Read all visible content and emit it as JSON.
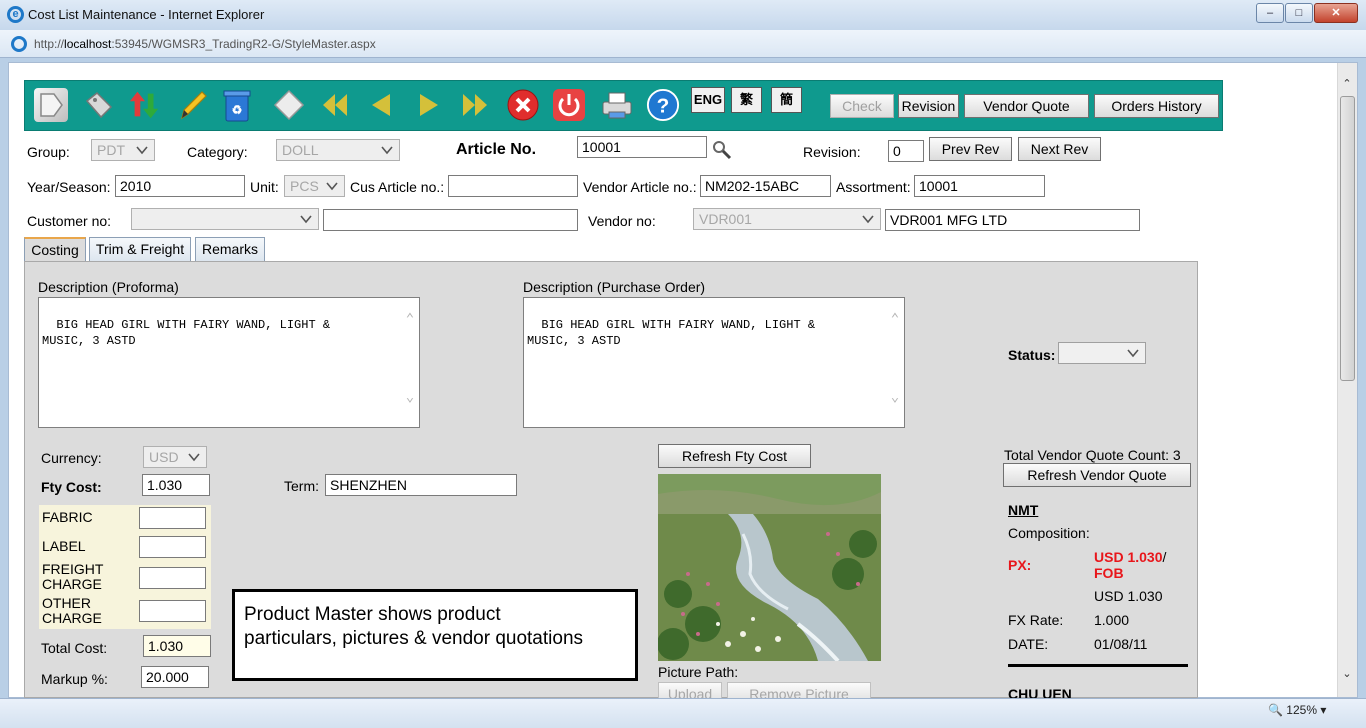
{
  "window": {
    "title": "Cost List Maintenance - Internet Explorer",
    "url_prefix": "http://",
    "url_host": "localhost",
    "url_rest": ":53945/WGMSR3_TradingR2-G/StyleMaster.aspx",
    "zoom": "125%"
  },
  "toolbar": {
    "icons": [
      "new-icon",
      "tag-icon",
      "sort-icon",
      "edit-icon",
      "recycle-icon",
      "clear-icon",
      "first-icon",
      "prev-icon",
      "next-icon",
      "last-icon",
      "cancel-icon",
      "power-icon",
      "print-icon",
      "help-icon"
    ],
    "lang_eng": "ENG",
    "lang_trad": "繁",
    "lang_simp": "簡",
    "check": "Check",
    "revision": "Revision",
    "vendor_quote": "Vendor Quote",
    "orders_history": "Orders History"
  },
  "header": {
    "group_label": "Group:",
    "group_value": "PDT",
    "category_label": "Category:",
    "category_value": "DOLL",
    "article_label": "Article No.",
    "article_value": "10001",
    "revision_label": "Revision:",
    "revision_value": "0",
    "prev_rev": "Prev Rev",
    "next_rev": "Next Rev",
    "year_label": "Year/Season:",
    "year_value": "2010",
    "unit_label": "Unit:",
    "unit_value": "PCS",
    "cus_article_label": "Cus Article no.:",
    "cus_article_value": "",
    "vendor_article_label": "Vendor Article no.:",
    "vendor_article_value": "NM202-15ABC",
    "assortment_label": "Assortment:",
    "assortment_value": "10001",
    "customer_label": "Customer no:",
    "customer_value": "",
    "customer_name": "",
    "vendor_label": "Vendor no:",
    "vendor_value": "VDR001",
    "vendor_name": "VDR001 MFG LTD"
  },
  "tabs": [
    "Costing",
    "Trim & Freight",
    "Remarks"
  ],
  "costing": {
    "desc_proforma_label": "Description (Proforma)",
    "desc_proforma": "BIG HEAD GIRL WITH FAIRY WAND, LIGHT &\nMUSIC, 3 ASTD",
    "desc_po_label": "Description (Purchase Order)",
    "desc_po": "BIG HEAD GIRL WITH FAIRY WAND, LIGHT &\nMUSIC, 3 ASTD",
    "status_label": "Status:",
    "status_value": "",
    "currency_label": "Currency:",
    "currency_value": "USD",
    "fty_cost_label": "Fty Cost:",
    "fty_cost_value": "1.030",
    "term_label": "Term:",
    "term_value": "SHENZHEN",
    "cost_rows": [
      {
        "label": "FABRIC",
        "value": ""
      },
      {
        "label": "LABEL",
        "value": ""
      },
      {
        "label": "FREIGHT\nCHARGE",
        "value": ""
      },
      {
        "label": "OTHER\nCHARGE",
        "value": ""
      }
    ],
    "total_cost_label": "Total Cost:",
    "total_cost_value": "1.030",
    "markup_label": "Markup %:",
    "markup_value": "20.000",
    "refresh_fty": "Refresh Fty Cost",
    "picture_path_label": "Picture Path:",
    "upload": "Upload",
    "remove_picture": "Remove Picture",
    "vq_count_label": "Total Vendor Quote Count: 3",
    "refresh_vq": "Refresh Vendor Quote",
    "vendor_code": "NMT",
    "composition_label": "Composition:",
    "px_label": "PX:",
    "px_value": "USD 1.030",
    "px_sep": "/",
    "px_term": "FOB",
    "px_usd": "USD 1.030",
    "fx_label": "FX Rate:",
    "fx_value": "1.000",
    "date_label": "DATE:",
    "date_value": "01/08/11",
    "vendor_code_2": "CHU UEN"
  },
  "callout": {
    "line1": "Product Master shows product",
    "line2": "particulars, pictures & vendor quotations"
  },
  "colors": {
    "toolbar": "#0f9a8e",
    "panel": "#dcdcdc",
    "price_red": "#e8161b"
  }
}
